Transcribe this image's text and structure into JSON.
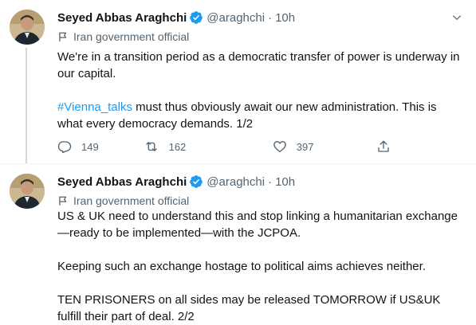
{
  "tweets": [
    {
      "author_name": "Seyed Abbas Araghchi",
      "handle": "@araghchi",
      "separator": "·",
      "time": "10h",
      "label": "Iran government official",
      "paragraph1": "We're in a transition period as a democratic transfer of power is underway in our capital.",
      "hashtag": "#Vienna_talks",
      "paragraph2_rest": " must thus obviously await our new administration. This is what every democracy demands. 1/2",
      "replies": "149",
      "retweets": "162",
      "likes": "397"
    },
    {
      "author_name": "Seyed Abbas Araghchi",
      "handle": "@araghchi",
      "separator": "·",
      "time": "10h",
      "label": "Iran government official",
      "paragraphs": [
        "US & UK need to understand this and stop linking a humanitarian exchange —ready to be implemented—with the JCPOA.",
        "Keeping such an exchange hostage to political aims achieves neither.",
        "TEN PRISONERS on all sides may be released TOMORROW if US&UK fulfill their part of deal. 2/2"
      ]
    }
  ],
  "icons": {
    "verified": "verified-badge-icon",
    "flag": "flag-icon",
    "more": "chevron-down-icon",
    "reply": "reply-icon",
    "retweet": "retweet-icon",
    "like": "heart-icon",
    "share": "share-icon"
  },
  "colors": {
    "accent": "#1d9bf0",
    "secondary_text": "#536471"
  }
}
